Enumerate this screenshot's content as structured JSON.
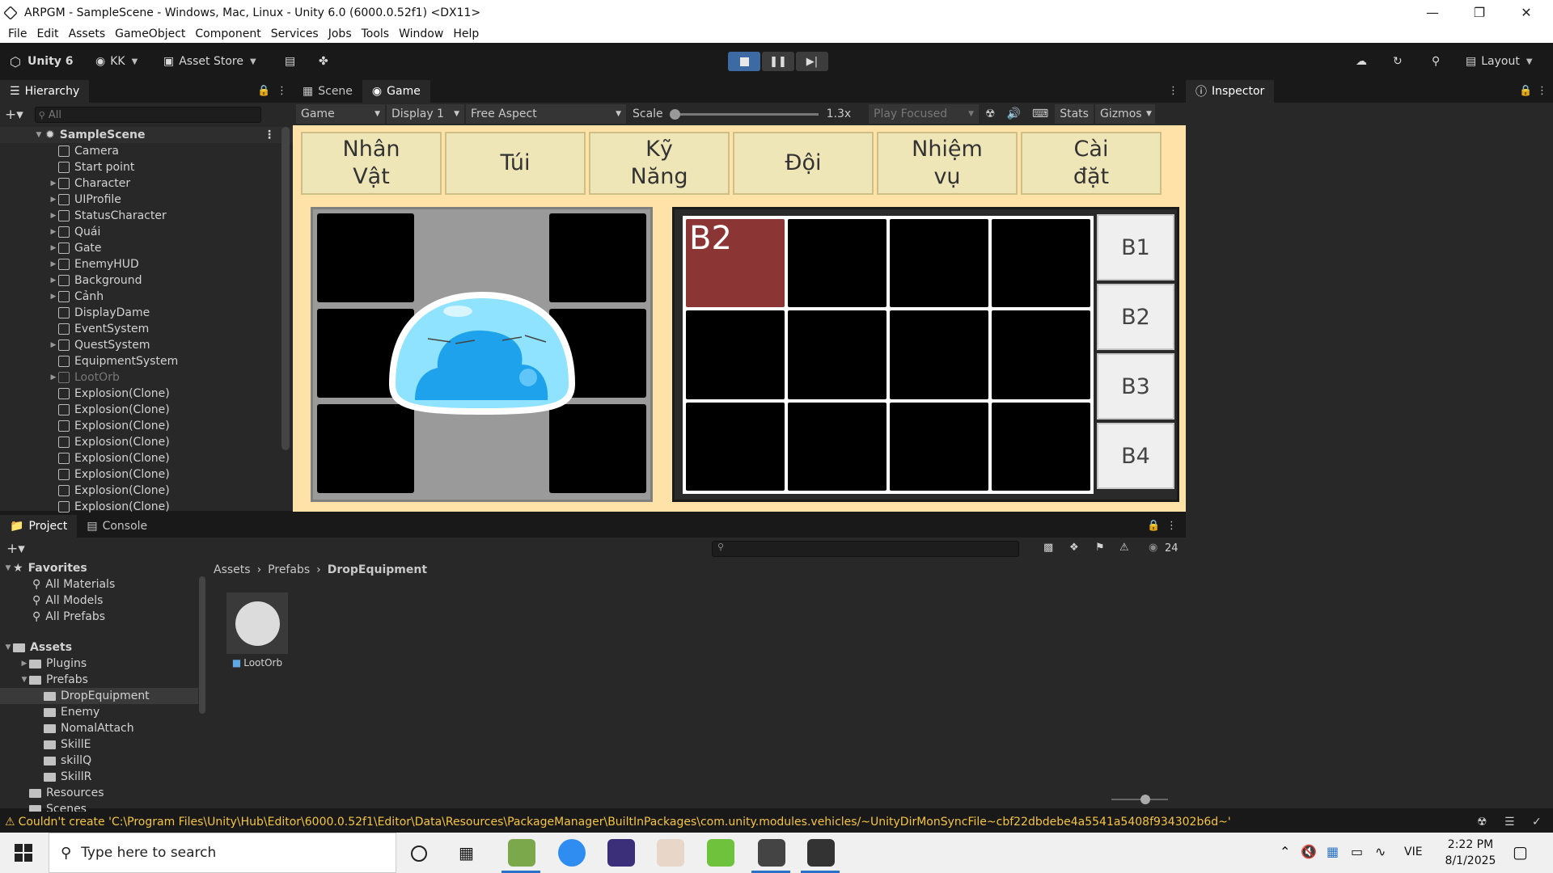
{
  "window": {
    "title": "ARPGM - SampleScene - Windows, Mac, Linux - Unity 6.0 (6000.0.52f1) <DX11>"
  },
  "menu": [
    "File",
    "Edit",
    "Assets",
    "GameObject",
    "Component",
    "Services",
    "Jobs",
    "Tools",
    "Window",
    "Help"
  ],
  "toolbar": {
    "unity_label": "Unity 6",
    "account": "KK",
    "asset_store": "Asset Store",
    "layout": "Layout"
  },
  "tabs": {
    "hierarchy": "Hierarchy",
    "scene": "Scene",
    "game": "Game",
    "inspector": "Inspector",
    "project": "Project",
    "console": "Console"
  },
  "hierarchy": {
    "search_placeholder": "All",
    "scene": "SampleScene",
    "items": [
      {
        "label": "Camera",
        "expandable": false
      },
      {
        "label": "Start point",
        "expandable": false
      },
      {
        "label": "Character",
        "expandable": true
      },
      {
        "label": "UIProfile",
        "expandable": true
      },
      {
        "label": "StatusCharacter",
        "expandable": true
      },
      {
        "label": "Quái",
        "expandable": true
      },
      {
        "label": "Gate",
        "expandable": true
      },
      {
        "label": "EnemyHUD",
        "expandable": true
      },
      {
        "label": "Background",
        "expandable": true
      },
      {
        "label": "Cảnh",
        "expandable": true
      },
      {
        "label": "DisplayDame",
        "expandable": false
      },
      {
        "label": "EventSystem",
        "expandable": false
      },
      {
        "label": "QuestSystem",
        "expandable": true
      },
      {
        "label": "EquipmentSystem",
        "expandable": false
      },
      {
        "label": "LootOrb",
        "expandable": true,
        "disabled": true
      },
      {
        "label": "Explosion(Clone)",
        "expandable": false
      },
      {
        "label": "Explosion(Clone)",
        "expandable": false
      },
      {
        "label": "Explosion(Clone)",
        "expandable": false
      },
      {
        "label": "Explosion(Clone)",
        "expandable": false
      },
      {
        "label": "Explosion(Clone)",
        "expandable": false
      },
      {
        "label": "Explosion(Clone)",
        "expandable": false
      },
      {
        "label": "Explosion(Clone)",
        "expandable": false
      },
      {
        "label": "Explosion(Clone)",
        "expandable": false
      }
    ]
  },
  "gamebar": {
    "view": "Game",
    "display": "Display 1",
    "aspect": "Free Aspect",
    "scale_label": "Scale",
    "scale_value": "1.3x",
    "play_mode": "Play Focused",
    "stats": "Stats",
    "gizmos": "Gizmos"
  },
  "game": {
    "top_buttons": [
      "Nhân\nVật",
      "Túi",
      "Kỹ\nNăng",
      "Đội",
      "Nhiệm\nvụ",
      "Cài\nđặt"
    ],
    "selected_cell_label": "B2",
    "bag_tabs": [
      "B1",
      "B2",
      "B3",
      "B4"
    ]
  },
  "project": {
    "favorites": "Favorites",
    "fav_items": [
      "All Materials",
      "All Models",
      "All Prefabs"
    ],
    "assets": "Assets",
    "tree": [
      {
        "label": "Plugins",
        "depth": 1,
        "expandable": true
      },
      {
        "label": "Prefabs",
        "depth": 1,
        "expandable": true,
        "open": true
      },
      {
        "label": "DropEquipment",
        "depth": 2,
        "selected": true
      },
      {
        "label": "Enemy",
        "depth": 2
      },
      {
        "label": "NomalAttach",
        "depth": 2
      },
      {
        "label": "SkillE",
        "depth": 2
      },
      {
        "label": "skillQ",
        "depth": 2
      },
      {
        "label": "SkillR",
        "depth": 2
      },
      {
        "label": "Resources",
        "depth": 1
      },
      {
        "label": "Scenes",
        "depth": 1
      }
    ],
    "breadcrumb": [
      "Assets",
      "Prefabs",
      "DropEquipment"
    ],
    "asset_name": "LootOrb",
    "hidden_count": "24"
  },
  "status": {
    "message": "Couldn't create 'C:\\Program Files\\Unity\\Hub\\Editor\\6000.0.52f1\\Editor\\Data\\Resources\\PackageManager\\BuiltInPackages\\com.unity.modules.vehicles/~UnityDirMonSyncFile~cbf22dbdebe4a5541a5408f934302b6d~'"
  },
  "taskbar": {
    "search_placeholder": "Type here to search",
    "lang": "VIE",
    "time": "2:22 PM",
    "date": "8/1/2025"
  }
}
